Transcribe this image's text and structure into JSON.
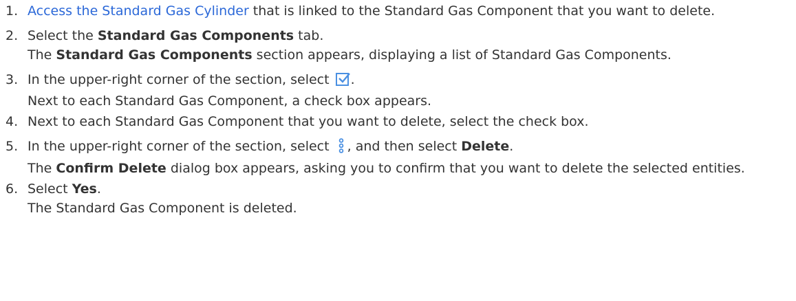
{
  "steps": [
    {
      "number": "1.",
      "link_text": "Access the Standard Gas Cylinder",
      "text_after": " that is linked to the Standard Gas Component that you want to delete."
    },
    {
      "number": "2.",
      "text_before": "Select the ",
      "bold": "Standard Gas Components",
      "text_after": " tab.",
      "result_bold": "Standard Gas Components",
      "result_after": " section appears, displaying a list of Standard Gas Components."
    },
    {
      "number": "3.",
      "text_before": "In the upper-right corner of the section, select ",
      "icon": "check-box-icon",
      "text_after": ".",
      "result": "Next to each Standard Gas Component, a check box appears."
    },
    {
      "number": "4.",
      "text": "Next to each Standard Gas Component that you want to delete, select the check box."
    },
    {
      "number": "5.",
      "text_before": "In the upper-right corner of the section, select ",
      "icon": "kebab-menu-icon",
      "text_mid": ", and then select ",
      "bold": "Delete",
      "text_after": ".",
      "result_bold": "Confirm Delete",
      "result_after": " dialog box appears, asking you to confirm that you want to delete the selected entities."
    },
    {
      "number": "6.",
      "text_before": "Select ",
      "bold": "Yes",
      "text_after": ".",
      "result": "The Standard Gas Component is deleted."
    }
  ],
  "colors": {
    "text": "#333333",
    "link": "#2b68d8",
    "icon": "#4a90e2"
  }
}
